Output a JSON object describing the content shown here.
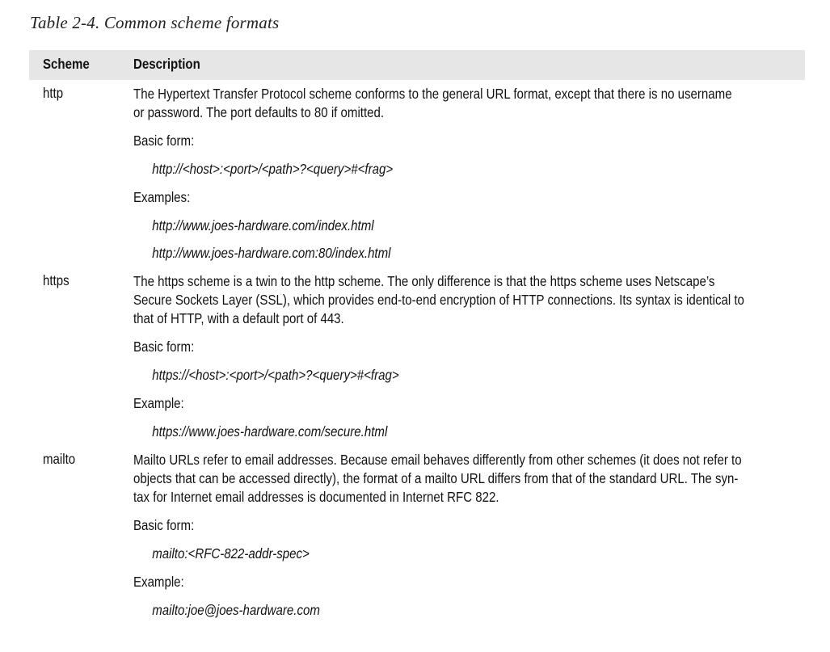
{
  "caption": "Table 2-4. Common scheme formats",
  "headers": {
    "scheme": "Scheme",
    "description": "Description"
  },
  "rows": [
    {
      "scheme": "http",
      "desc_lines": [
        "The Hypertext Transfer Protocol scheme conforms to the general URL format, except that there is no username",
        "or password. The port defaults to 80 if omitted."
      ],
      "basic_label": "Basic form:",
      "basic_form": "http://<host>:<port>/<path>?<query>#<frag>",
      "example_label": "Examples:",
      "examples": [
        "http://www.joes-hardware.com/index.html",
        "http://www.joes-hardware.com:80/index.html"
      ]
    },
    {
      "scheme": "https",
      "desc_lines": [
        "The https scheme is a twin to the http scheme. The only difference is that the https scheme uses Netscape’s",
        "Secure Sockets Layer (SSL), which provides end-to-end encryption of HTTP connections. Its syntax is identical to",
        "that of HTTP, with a default port of 443."
      ],
      "basic_label": "Basic form:",
      "basic_form": "https://<host>:<port>/<path>?<query>#<frag>",
      "example_label": "Example:",
      "examples": [
        "https://www.joes-hardware.com/secure.html"
      ]
    },
    {
      "scheme": "mailto",
      "desc_lines": [
        "Mailto URLs refer to email addresses. Because email behaves differently from other schemes (it does not refer to",
        "objects that can be accessed directly), the format of a mailto URL differs from that of the standard URL. The syn-",
        "tax for Internet email addresses is documented in Internet RFC 822."
      ],
      "basic_label": "Basic form:",
      "basic_form": "mailto:<RFC-822-addr-spec>",
      "example_label": "Example:",
      "examples": [
        "mailto:joe@joes-hardware.com"
      ]
    }
  ]
}
